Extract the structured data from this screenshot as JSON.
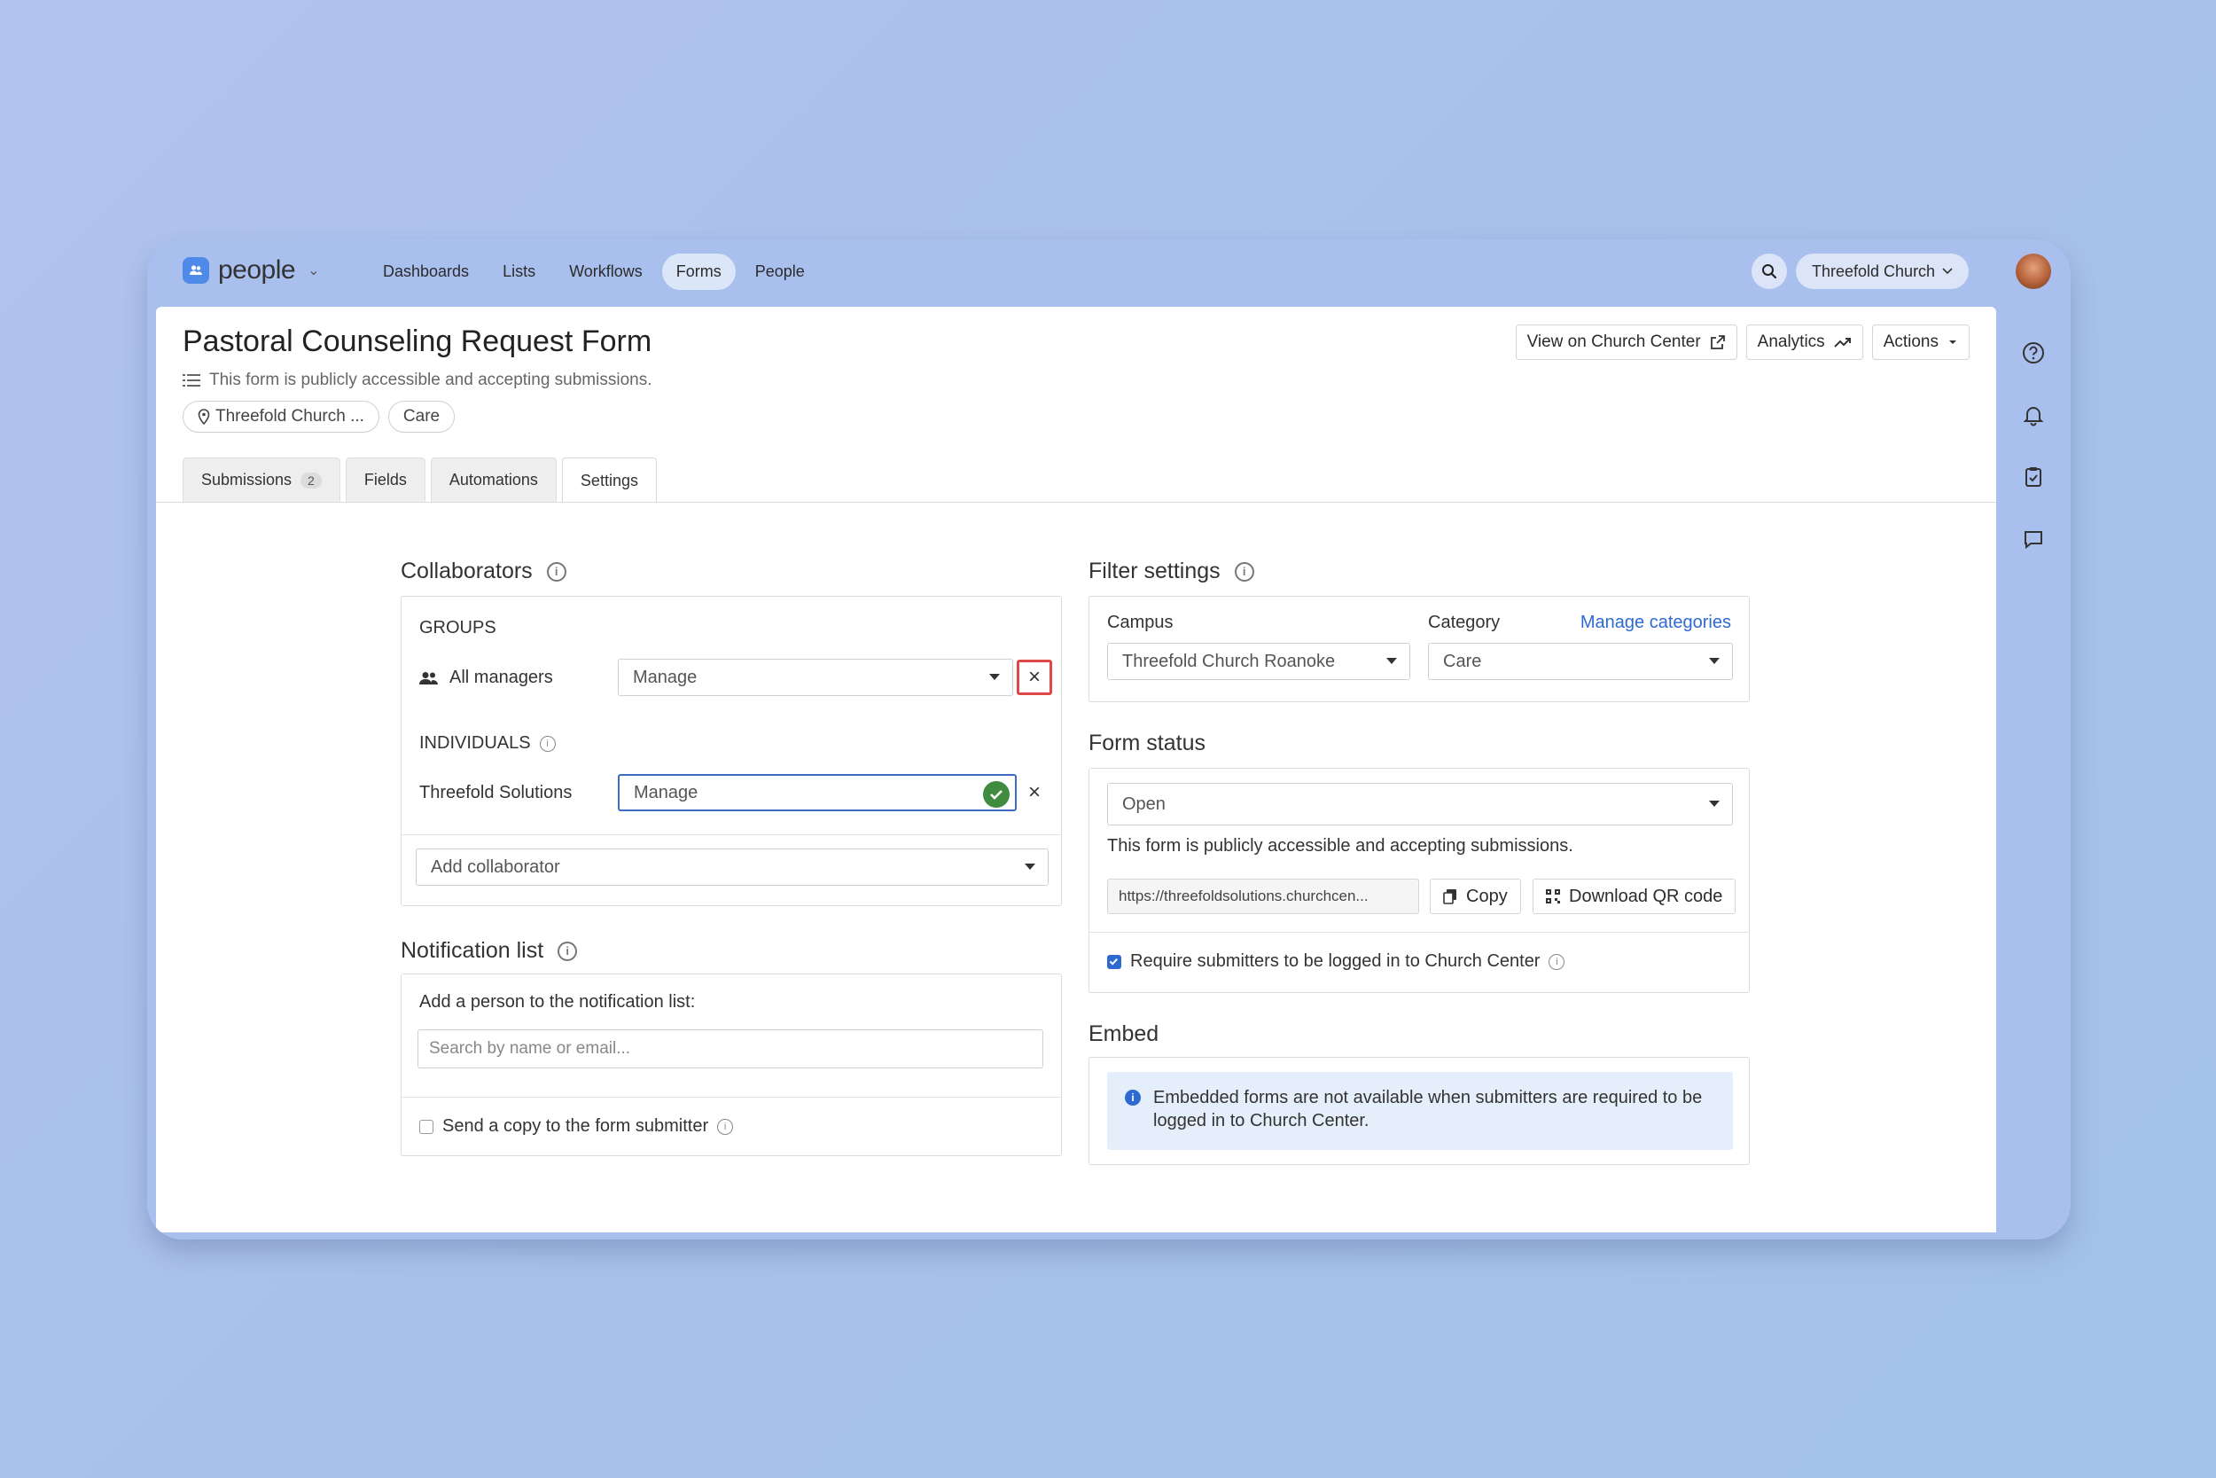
{
  "app": {
    "name": "people"
  },
  "nav": {
    "items": [
      "Dashboards",
      "Lists",
      "Workflows",
      "Forms",
      "People"
    ],
    "active": "Forms"
  },
  "org_switcher": {
    "label": "Threefold Church"
  },
  "header": {
    "title": "Pastoral Counseling Request Form",
    "subtitle": "This form is publicly accessible and accepting submissions.",
    "chips": [
      "Threefold Church ...",
      "Care"
    ],
    "buttons": {
      "view": "View on Church Center",
      "analytics": "Analytics",
      "actions": "Actions"
    }
  },
  "tabs": {
    "submissions": {
      "label": "Submissions",
      "count": "2"
    },
    "fields": "Fields",
    "automations": "Automations",
    "settings": "Settings"
  },
  "collaborators": {
    "title": "Collaborators",
    "groups_heading": "GROUPS",
    "group_name": "All managers",
    "group_permission": "Manage",
    "individuals_heading": "INDIVIDUALS",
    "individual_name": "Threefold Solutions",
    "individual_permission": "Manage",
    "add_placeholder": "Add collaborator"
  },
  "notification": {
    "title": "Notification list",
    "add_label": "Add a person to the notification list:",
    "search_placeholder": "Search by name or email...",
    "send_copy": "Send a copy to the form submitter"
  },
  "filter": {
    "title": "Filter settings",
    "campus_label": "Campus",
    "campus_value": "Threefold Church Roanoke",
    "category_label": "Category",
    "manage_categories": "Manage categories",
    "category_value": "Care"
  },
  "status": {
    "title": "Form status",
    "value": "Open",
    "description": "This form is publicly accessible and accepting submissions.",
    "url": "https://threefoldsolutions.churchcen...",
    "copy": "Copy",
    "download_qr": "Download QR code",
    "require_login": "Require submitters to be logged in to Church Center",
    "require_login_checked": true
  },
  "embed": {
    "title": "Embed",
    "message": "Embedded forms are not available when submitters are required to be logged in to Church Center."
  },
  "colors": {
    "accent": "#2f6ad0",
    "success": "#3f8b3f",
    "highlight": "#e04848",
    "background": "#a9bfee"
  }
}
